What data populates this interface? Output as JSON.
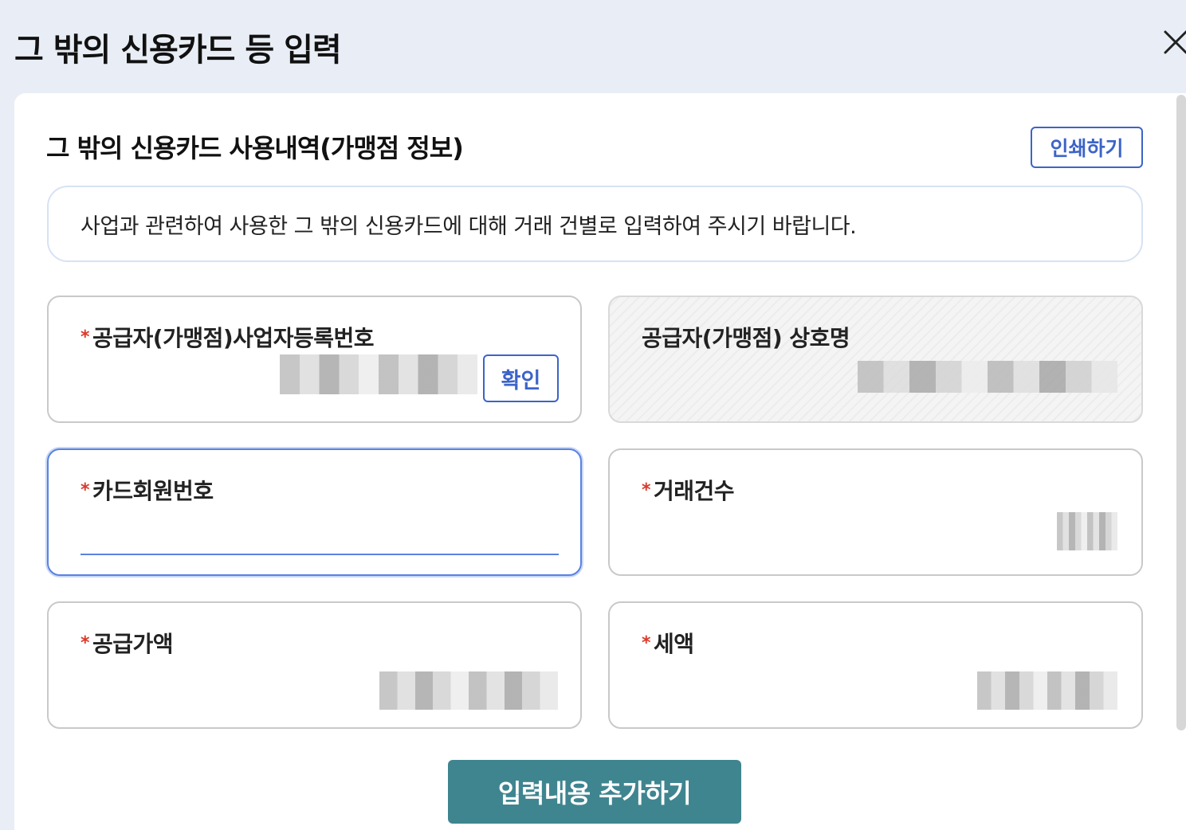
{
  "modal": {
    "title": "그 밖의 신용카드 등 입력",
    "close_icon": "close-icon"
  },
  "section": {
    "title": "그 밖의 신용카드 사용내역(가맹점 정보)",
    "print_label": "인쇄하기"
  },
  "notice": {
    "text": "사업과 관련하여 사용한 그 밖의 신용카드에 대해 거래 건별로 입력하여 주시기 바랍니다."
  },
  "fields": {
    "biz_no": {
      "label": "공급자(가맹점)사업자등록번호",
      "required": "*",
      "confirm_label": "확인"
    },
    "store_name": {
      "label": "공급자(가맹점) 상호명"
    },
    "card_no": {
      "label": "카드회원번호",
      "required": "*",
      "value": ""
    },
    "tx_count": {
      "label": "거래건수",
      "required": "*"
    },
    "supply_amount": {
      "label": "공급가액",
      "required": "*"
    },
    "tax": {
      "label": "세액",
      "required": "*"
    }
  },
  "actions": {
    "add_label": "입력내용 추가하기"
  },
  "colors": {
    "accent_blue": "#3c64c8",
    "required_red": "#d93a2a",
    "add_button_teal": "#3f8590",
    "header_bg": "#e9eef6"
  }
}
